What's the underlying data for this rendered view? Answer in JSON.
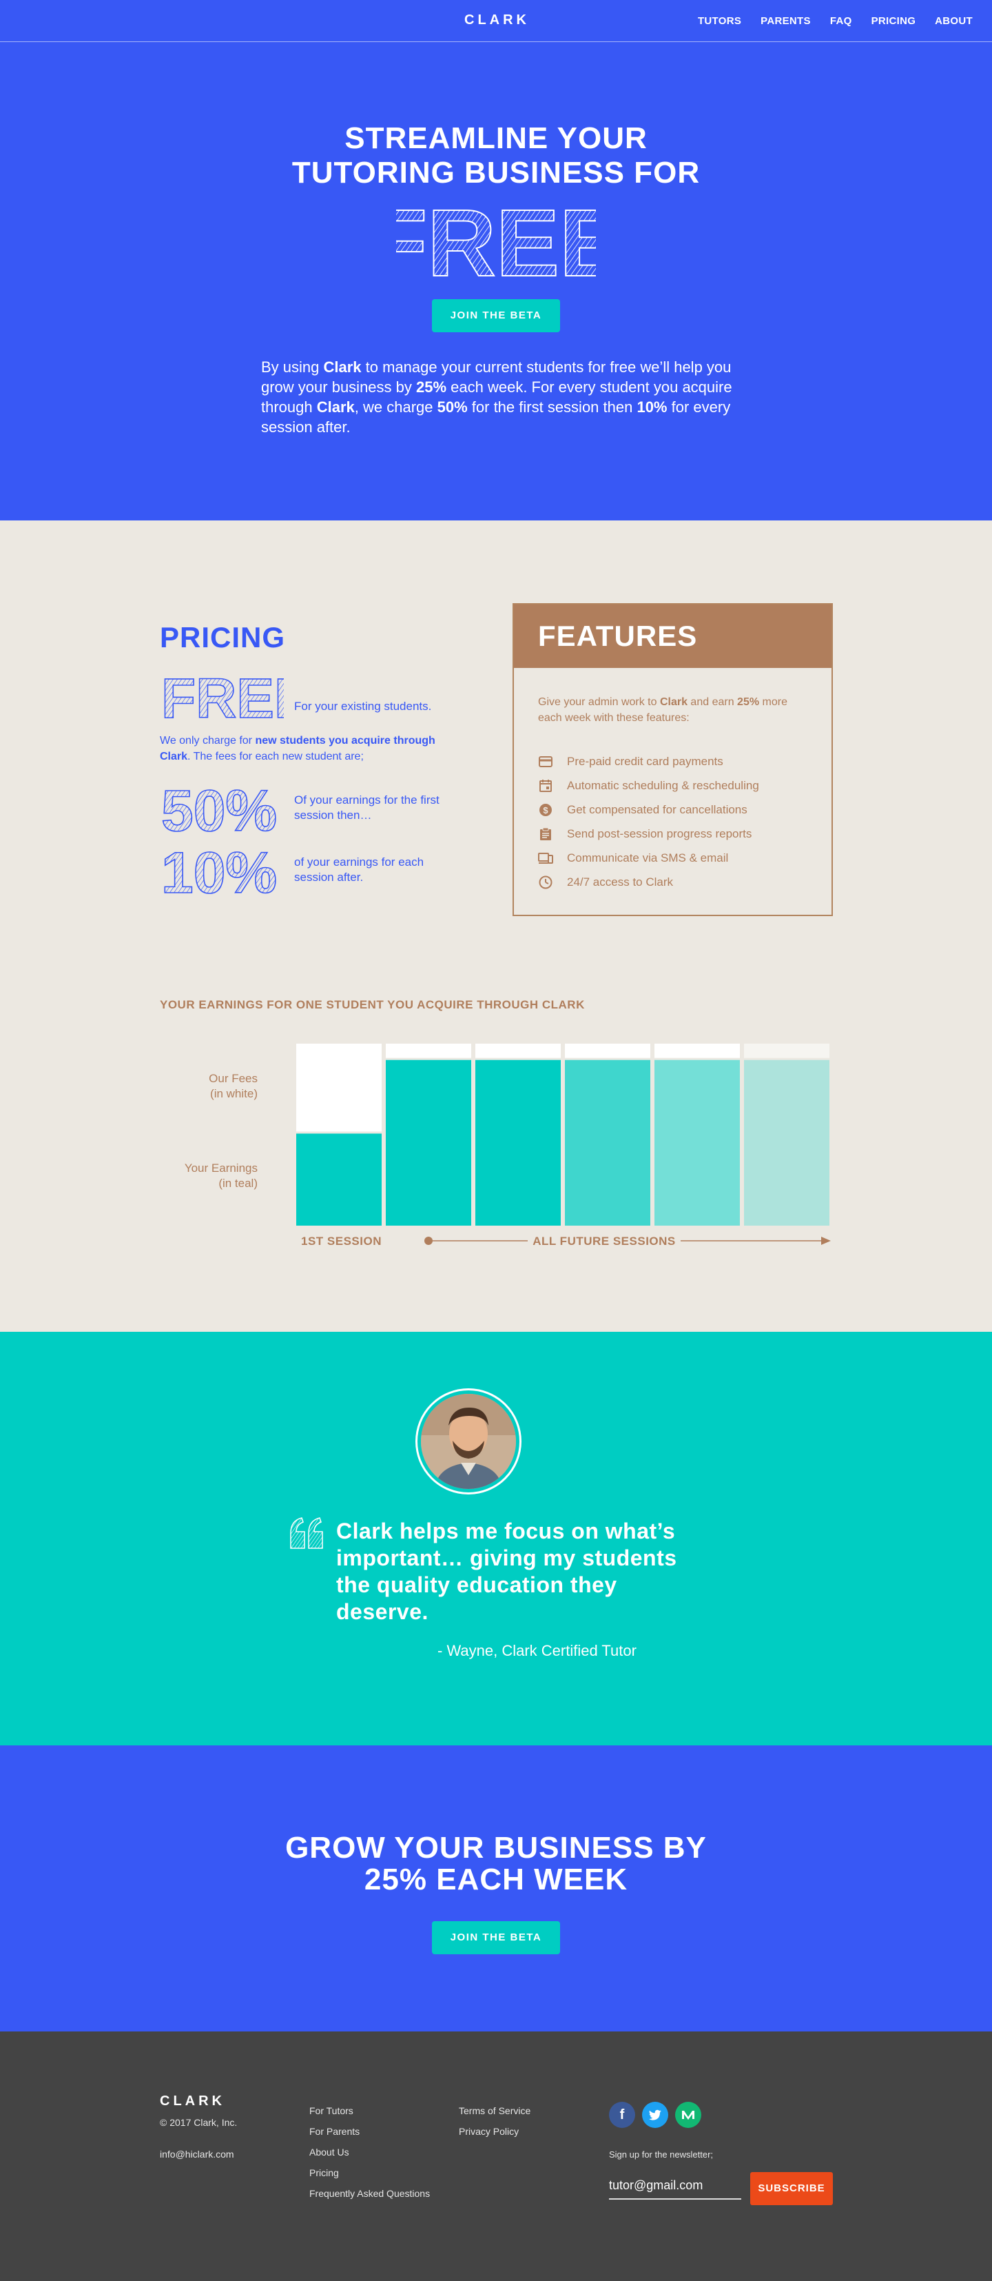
{
  "nav": {
    "brand": "CLARK",
    "links": [
      "TUTORS",
      "PARENTS",
      "FAQ",
      "PRICING",
      "ABOUT"
    ]
  },
  "hero": {
    "title_line1": "STREAMLINE YOUR",
    "title_line2": "TUTORING BUSINESS FOR",
    "free_word": "FREE",
    "cta": "JOIN THE BETA",
    "para": {
      "p1": "By using ",
      "clark1": "Clark",
      "p2": " to manage your current students for free we’ll help you grow your business by ",
      "pct25": "25%",
      "p3": " each week. For every student you acquire through ",
      "clark2": "Clark",
      "p4": ", we charge ",
      "pct50": "50%",
      "p5": " for the first session then ",
      "pct10": "10%",
      "p6": " for every session after."
    }
  },
  "pricing": {
    "heading": "PRICING",
    "free_word": "FREE",
    "free_label": "For your existing students.",
    "charge": {
      "pre": "We only charge for ",
      "bold": "new students you acquire through Clark",
      "post": ". The fees for each new student are;"
    },
    "fifty_word": "50%",
    "fifty_label": "Of your earnings for the first session then…",
    "ten_word": "10%",
    "ten_label": "of your earnings for each session after."
  },
  "features": {
    "heading": "FEATURES",
    "intro": {
      "pre": "Give your admin work to ",
      "clark": "Clark",
      "mid": " and earn ",
      "pct": "25%",
      "post": " more each week with these features:"
    },
    "items": [
      {
        "icon": "credit-card-icon",
        "label": "Pre-paid credit card payments"
      },
      {
        "icon": "calendar-icon",
        "label": "Automatic scheduling & rescheduling"
      },
      {
        "icon": "dollar-coin-icon",
        "label": "Get compensated for cancellations"
      },
      {
        "icon": "clipboard-icon",
        "label": "Send post-session progress reports"
      },
      {
        "icon": "devices-icon",
        "label": "Communicate via SMS & email"
      },
      {
        "icon": "clock-icon",
        "label": "24/7 access to Clark"
      }
    ]
  },
  "earnings": {
    "title": "YOUR EARNINGS FOR ONE STUDENT YOU ACQUIRE THROUGH CLARK",
    "label_fees": [
      "Our Fees",
      "(in white)"
    ],
    "label_earnings": [
      "Your Earnings",
      "(in teal)"
    ],
    "first_session": "1ST SESSION",
    "future_sessions": "ALL FUTURE SESSIONS"
  },
  "chart_data": {
    "type": "bar",
    "stacked": true,
    "categories": [
      "1ST SESSION",
      "",
      "",
      "",
      "",
      ""
    ],
    "series": [
      {
        "name": "Your Earnings",
        "values": [
          50,
          90,
          90,
          90,
          90,
          90
        ],
        "colors": [
          "#00cdc2",
          "#00cdc2",
          "#00cdc2",
          "#3fd6cd",
          "#74dfd7",
          "#ade3dc"
        ]
      },
      {
        "name": "Our Fees",
        "values": [
          50,
          10,
          10,
          10,
          10,
          10
        ],
        "color": "#ffffff"
      }
    ],
    "ylim": [
      0,
      100
    ]
  },
  "testimonial": {
    "quote": "Clark helps me focus on what’s important… giving my students the quality education they deserve.",
    "author": "- Wayne, Clark Certified Tutor"
  },
  "cta": {
    "line1": "GROW YOUR BUSINESS BY",
    "line2": "25% EACH WEEK",
    "button": "JOIN THE BETA"
  },
  "footer": {
    "brand": "CLARK",
    "copyright": "© 2017 Clark, Inc.",
    "email": "info@hiclark.com",
    "col1": [
      "For Tutors",
      "For Parents",
      "About Us",
      "Pricing",
      "Frequently Asked Questions"
    ],
    "col2": [
      "Terms of Service",
      "Privacy Policy"
    ],
    "social": [
      "facebook-icon",
      "twitter-icon",
      "medium-icon"
    ],
    "newsletter_label": "Sign up for the newsletter;",
    "newsletter_placeholder": "tutor@gmail.com",
    "subscribe": "SUBSCRIBE"
  },
  "colors": {
    "blue": "#3858f5",
    "teal": "#00cdc2",
    "brown": "#b07e5c",
    "beige": "#ece8e1",
    "footer": "#444444",
    "orange": "#ec4a19"
  }
}
